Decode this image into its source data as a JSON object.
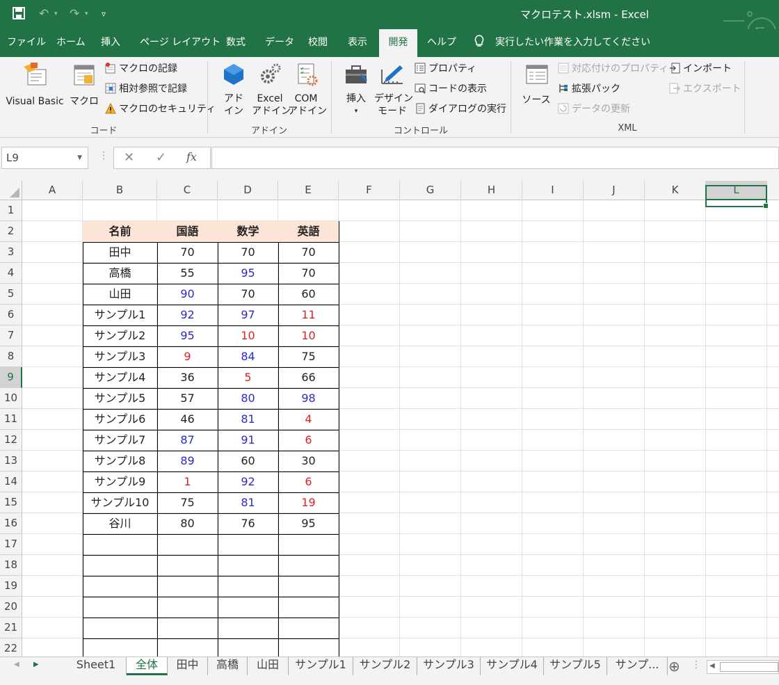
{
  "title": "マクロテスト.xlsm  -  Excel",
  "quick_access": {
    "save": "save-icon",
    "undo": "undo-icon",
    "redo": "redo-icon",
    "customize": "customize-icon"
  },
  "tabs": [
    "ファイル",
    "ホーム",
    "挿入",
    "ページ レイアウト",
    "数式",
    "データ",
    "校閲",
    "表示",
    "開発",
    "ヘルプ"
  ],
  "active_tab": "開発",
  "tell_me": "実行したい作業を入力してください",
  "ribbon": {
    "code": {
      "label": "コード",
      "visual_basic": "Visual Basic",
      "macro": "マクロ",
      "record_macro": "マクロの記録",
      "relative_ref": "相対参照で記録",
      "macro_security": "マクロのセキュリティ"
    },
    "addins": {
      "label": "アドイン",
      "addin_1": "アド",
      "addin_2": "イン",
      "excel_1": "Excel",
      "excel_2": "アドイン",
      "com_1": "COM",
      "com_2": "アドイン"
    },
    "controls": {
      "label": "コントロール",
      "insert": "挿入",
      "design_1": "デザイン",
      "design_2": "モード",
      "properties": "プロパティ",
      "view_code": "コードの表示",
      "run_dialog": "ダイアログの実行"
    },
    "xml": {
      "label": "XML",
      "source": "ソース",
      "map_props": "対応付けのプロパティ",
      "expansion": "拡張パック",
      "refresh": "データの更新",
      "import": "インポート",
      "export": "エクスポート"
    }
  },
  "name_box": "L9",
  "formula": "",
  "columns": [
    "A",
    "B",
    "C",
    "D",
    "E",
    "F",
    "G",
    "H",
    "I",
    "J",
    "K",
    "L"
  ],
  "rows": [
    "1",
    "2",
    "3",
    "4",
    "5",
    "6",
    "7",
    "8",
    "9",
    "10",
    "11",
    "12",
    "13",
    "14",
    "15",
    "16",
    "17",
    "18",
    "19",
    "20",
    "21",
    "22"
  ],
  "selected_cell": "L9",
  "table": {
    "headers": [
      "名前",
      "国語",
      "数学",
      "英語"
    ],
    "rows": [
      {
        "name": "田中",
        "v": [
          70,
          70,
          70
        ],
        "c": [
          "",
          "",
          ""
        ]
      },
      {
        "name": "高橋",
        "v": [
          55,
          95,
          70
        ],
        "c": [
          "",
          "blue",
          ""
        ]
      },
      {
        "name": "山田",
        "v": [
          90,
          70,
          60
        ],
        "c": [
          "blue",
          "",
          ""
        ]
      },
      {
        "name": "サンプル1",
        "v": [
          92,
          97,
          11
        ],
        "c": [
          "blue",
          "blue",
          "red"
        ]
      },
      {
        "name": "サンプル2",
        "v": [
          95,
          10,
          10
        ],
        "c": [
          "blue",
          "red",
          "red"
        ]
      },
      {
        "name": "サンプル3",
        "v": [
          9,
          84,
          75
        ],
        "c": [
          "red",
          "blue",
          ""
        ]
      },
      {
        "name": "サンプル4",
        "v": [
          36,
          5,
          66
        ],
        "c": [
          "",
          "red",
          ""
        ]
      },
      {
        "name": "サンプル5",
        "v": [
          57,
          80,
          98
        ],
        "c": [
          "",
          "blue",
          "blue"
        ]
      },
      {
        "name": "サンプル6",
        "v": [
          46,
          81,
          4
        ],
        "c": [
          "",
          "blue",
          "red"
        ]
      },
      {
        "name": "サンプル7",
        "v": [
          87,
          91,
          6
        ],
        "c": [
          "blue",
          "blue",
          "red"
        ]
      },
      {
        "name": "サンプル8",
        "v": [
          89,
          60,
          30
        ],
        "c": [
          "blue",
          "",
          ""
        ]
      },
      {
        "name": "サンプル9",
        "v": [
          1,
          92,
          6
        ],
        "c": [
          "red",
          "blue",
          "red"
        ]
      },
      {
        "name": "サンプル10",
        "v": [
          75,
          81,
          19
        ],
        "c": [
          "",
          "blue",
          "red"
        ]
      },
      {
        "name": "谷川",
        "v": [
          80,
          76,
          95
        ],
        "c": [
          "",
          "",
          ""
        ]
      }
    ],
    "empty_rows": 6
  },
  "sheets": [
    "Sheet1",
    "全体",
    "田中",
    "高橋",
    "山田",
    "サンプル1",
    "サンプル2",
    "サンプル3",
    "サンプル4",
    "サンプル5",
    "サンプ..."
  ],
  "active_sheet": "全体",
  "colors": {
    "accent": "#217346",
    "header_fill": "#fce4d6",
    "blue": "#2a2ac8",
    "red": "#e02020"
  }
}
